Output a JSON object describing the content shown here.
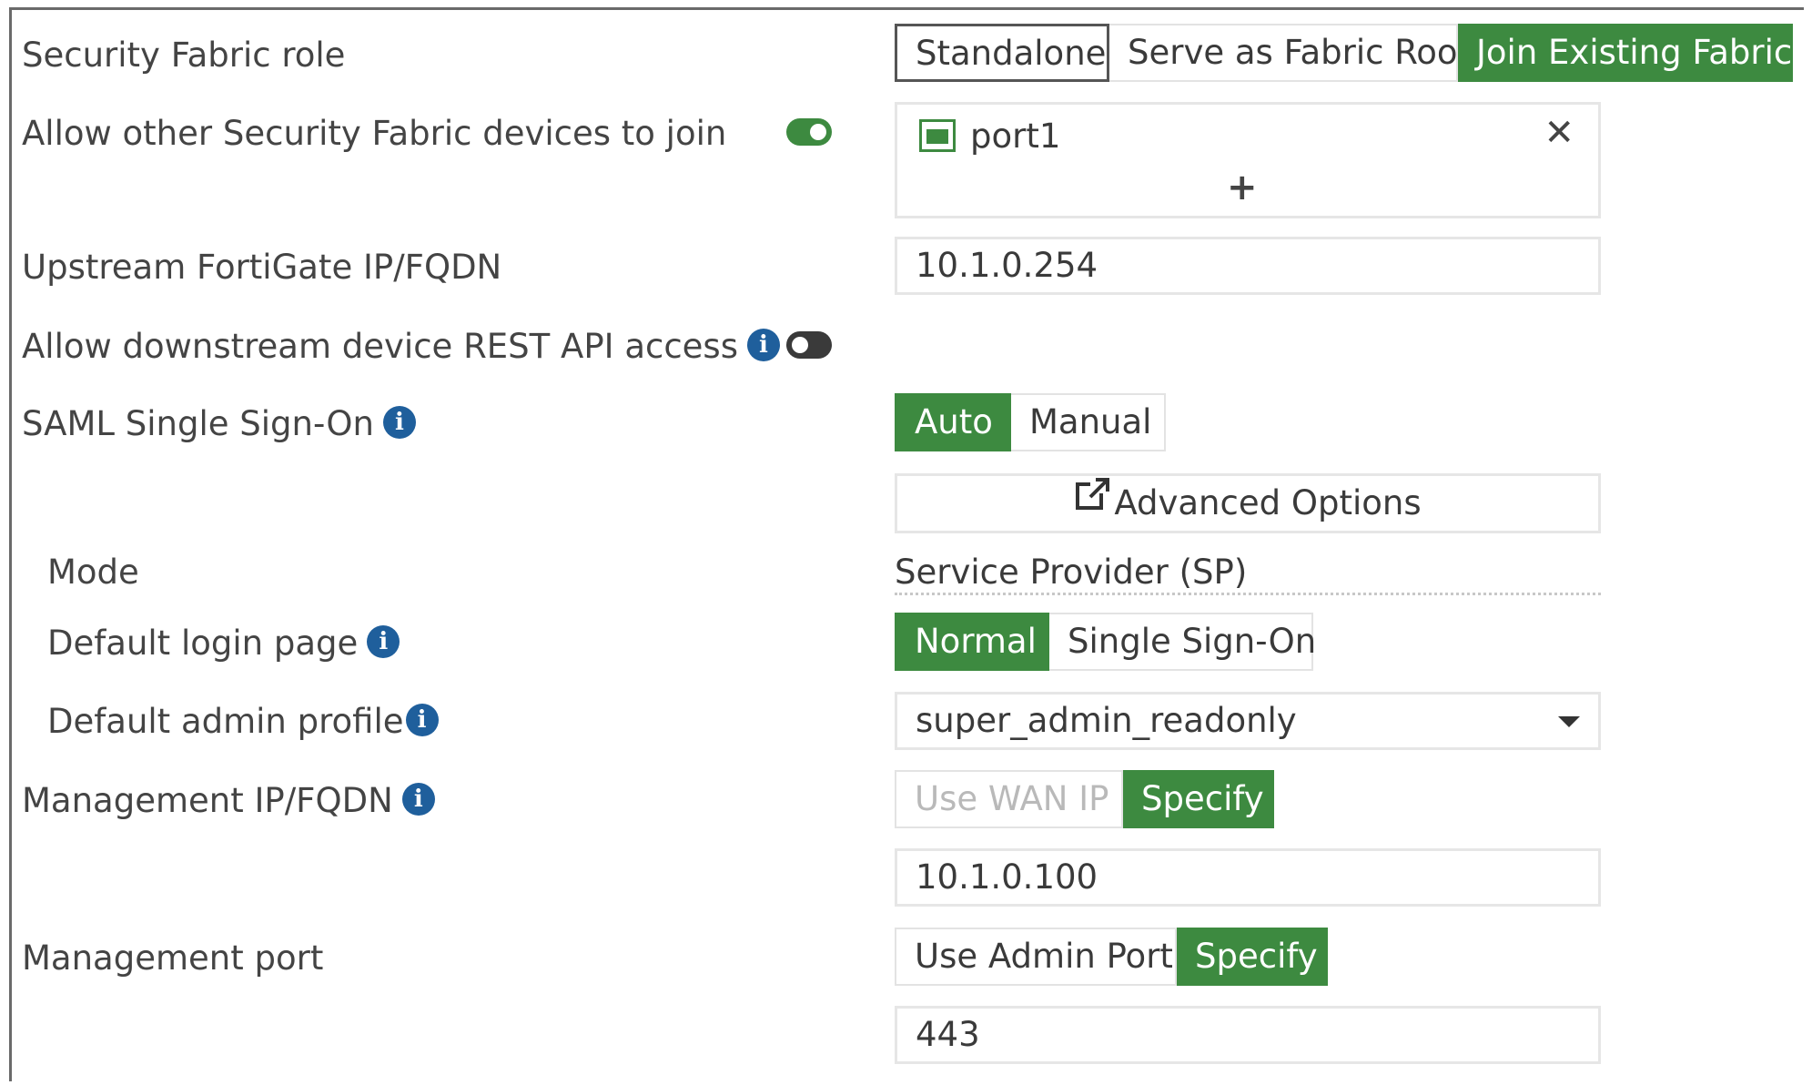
{
  "labels": {
    "fabric_role": "Security Fabric role",
    "allow_join": "Allow other Security Fabric devices to join",
    "upstream": "Upstream FortiGate IP/FQDN",
    "rest_api": "Allow downstream device REST API access",
    "saml": "SAML Single Sign-On",
    "mode": "Mode",
    "login_page": "Default login page",
    "admin_profile": "Default admin profile",
    "mgmt_ip": "Management IP/FQDN",
    "mgmt_port": "Management port"
  },
  "fabric_role": {
    "options": [
      "Standalone",
      "Serve as Fabric Root",
      "Join Existing Fabric"
    ],
    "selected": "Join Existing Fabric"
  },
  "allow_join": {
    "enabled": true,
    "interfaces": [
      "port1"
    ],
    "add_symbol": "+",
    "remove_symbol": "✕"
  },
  "upstream": {
    "value": "10.1.0.254"
  },
  "rest_api": {
    "enabled": false
  },
  "saml": {
    "options": [
      "Auto",
      "Manual"
    ],
    "selected": "Auto",
    "advanced_label": "Advanced Options"
  },
  "mode": {
    "value": "Service Provider (SP)"
  },
  "login_page": {
    "options": [
      "Normal",
      "Single Sign-On"
    ],
    "selected": "Normal"
  },
  "admin_profile": {
    "value": "super_admin_readonly"
  },
  "mgmt_ip": {
    "options": [
      "Use WAN IP",
      "Specify"
    ],
    "selected": "Specify",
    "value": "10.1.0.100"
  },
  "mgmt_port": {
    "options": [
      "Use Admin Port",
      "Specify"
    ],
    "selected": "Specify",
    "value": "443"
  },
  "colors": {
    "accent_green": "#3d8a40",
    "info_blue": "#1f5f9c"
  },
  "icons": {
    "info": "info-icon",
    "port": "network-port-icon",
    "external": "external-link-icon",
    "caret": "chevron-down-icon"
  }
}
